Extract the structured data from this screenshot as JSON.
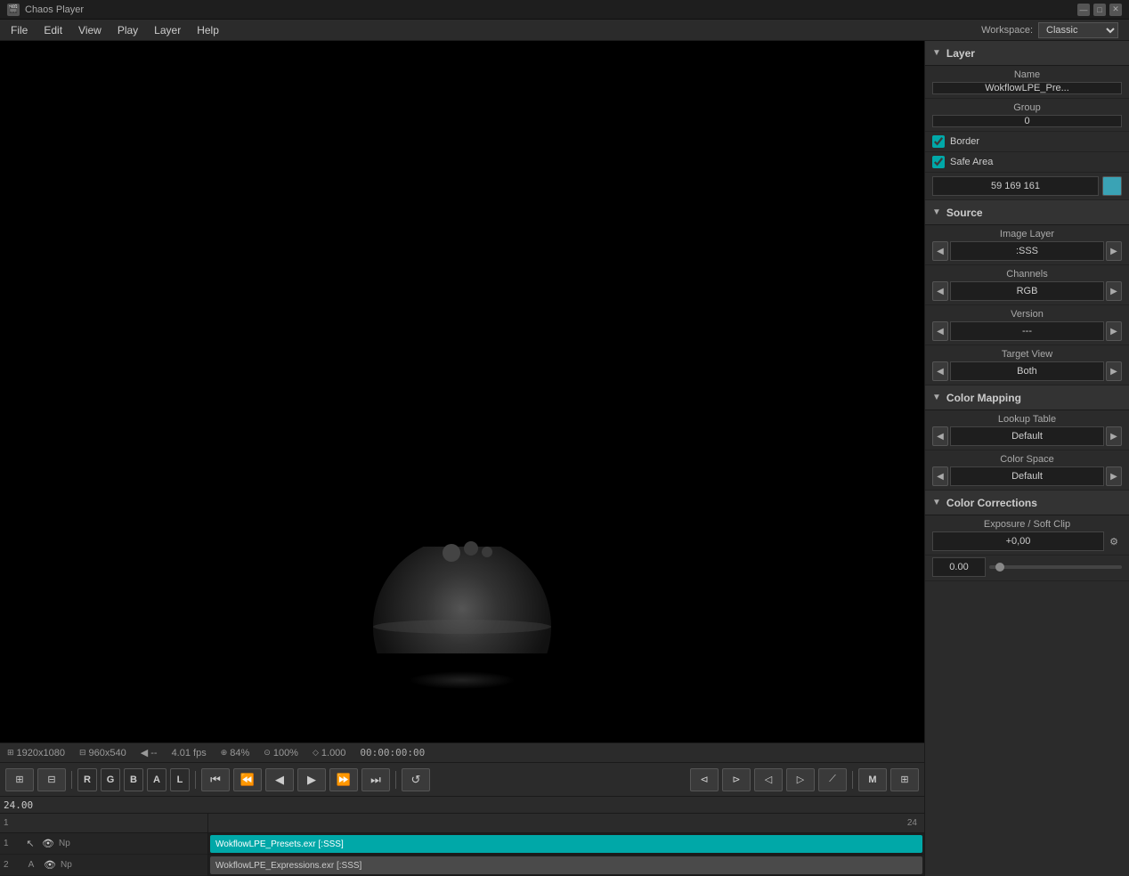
{
  "app": {
    "title": "Chaos Player",
    "icon": "🎬"
  },
  "window_controls": {
    "minimize": "—",
    "maximize": "□",
    "close": "✕"
  },
  "menubar": {
    "items": [
      "File",
      "Edit",
      "View",
      "Play",
      "Layer",
      "Help"
    ]
  },
  "workspace": {
    "label": "Workspace:",
    "value": "Classic"
  },
  "viewport": {
    "status": {
      "resolution1": "1920x1080",
      "resolution2": "960x540",
      "range": "--",
      "fps": "4.01 fps",
      "zoom_percent": "84%",
      "zoom_value": "100%",
      "ratio": "1.000",
      "timecode": "00:00:00:00"
    }
  },
  "transport": {
    "channel_buttons": [
      "R",
      "G",
      "B",
      "A",
      "L"
    ],
    "buttons": {
      "layout": "⊞",
      "split": "⊟",
      "skip_back": "⏮",
      "step_back": "⏪",
      "play_back": "◀",
      "play": "▶",
      "play_fwd": "⏩",
      "skip_fwd": "⏭",
      "loop": "↺",
      "in_point": "⬢",
      "out_point": "⬡",
      "trim_in": "⊲",
      "trim_out": "⊳",
      "ramp": "⟋",
      "mark": "M",
      "grid": "⊞"
    },
    "timecode": "24.00"
  },
  "right_panel": {
    "layer_section": {
      "title": "Layer",
      "name_label": "Name",
      "name_value": "WokflowLPE_Pre...",
      "group_label": "Group",
      "group_value": "0",
      "border_label": "Border",
      "border_checked": true,
      "safe_area_label": "Safe Area",
      "safe_area_checked": true,
      "color_value": "59 169 161"
    },
    "source_section": {
      "title": "Source",
      "image_layer_label": "Image Layer",
      "image_layer_value": ":SSS",
      "channels_label": "Channels",
      "channels_value": "RGB",
      "version_label": "Version",
      "version_value": "---",
      "target_view_label": "Target View",
      "target_view_value": "Both"
    },
    "color_mapping_section": {
      "title": "Color Mapping",
      "lookup_table_label": "Lookup Table",
      "lookup_table_value": "Default",
      "color_space_label": "Color Space",
      "color_space_value": "Default"
    },
    "color_corrections_section": {
      "title": "Color Corrections",
      "exposure_label": "Exposure / Soft Clip",
      "exposure_value": "+0,00",
      "exposure_value2": "0.00"
    }
  },
  "timeline": {
    "timecode": "24.00",
    "end_frame": "1",
    "ruler_end": "24",
    "tracks": [
      {
        "number": "1",
        "layer_type": "V",
        "visible": true,
        "np": "Np",
        "clip_name": "WokflowLPE_Presets.exr [:SSS]",
        "clip_color": "#00a8a8"
      },
      {
        "number": "2",
        "layer_type": "A",
        "visible": true,
        "np": "Np",
        "clip_name": "WokflowLPE_Expressions.exr [:SSS]",
        "clip_color": "#4a4a4a"
      }
    ]
  },
  "icons": {
    "arrow_left": "◀",
    "arrow_right": "▶",
    "arrow_down": "▼",
    "arrow_up": "▲",
    "eye": "👁",
    "cursor": "↖",
    "section_collapse": "▼",
    "section_expand": "▶",
    "color_picker": "⚙"
  }
}
